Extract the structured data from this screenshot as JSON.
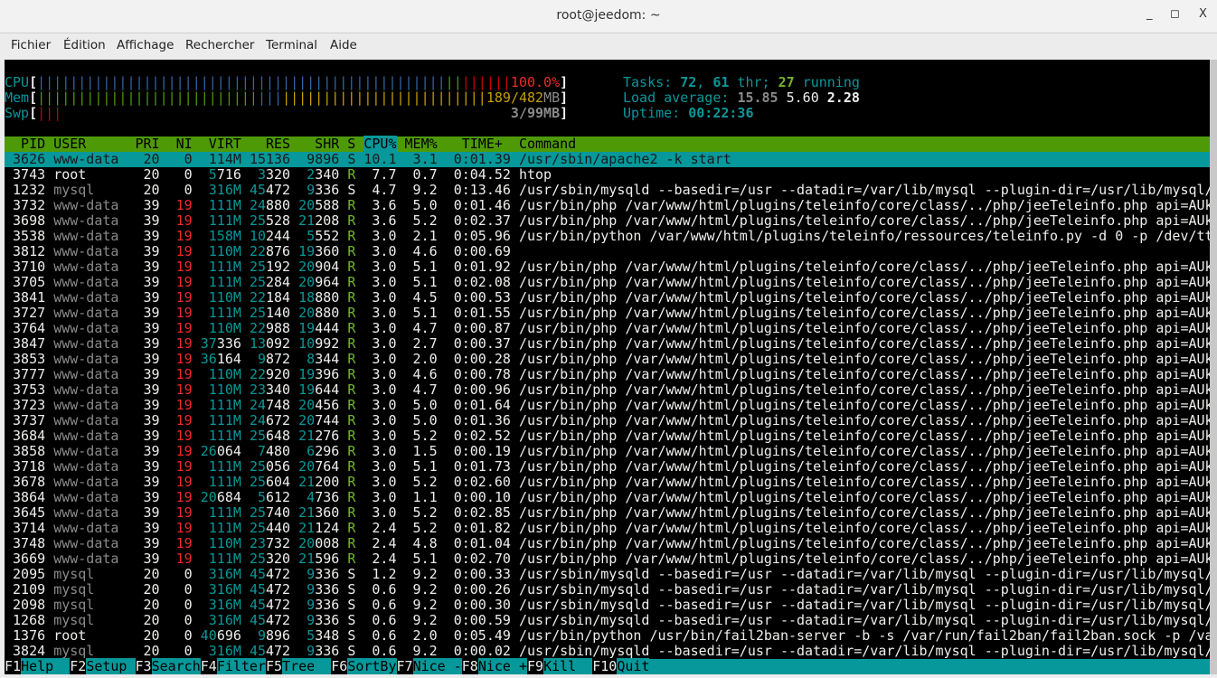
{
  "window": {
    "title": "root@jeedom: ~",
    "minimize": "_",
    "maximize": "◻",
    "close": "X"
  },
  "menu": [
    "Fichier",
    "Édition",
    "Affichage",
    "Rechercher",
    "Terminal",
    "Aide"
  ],
  "meters": {
    "cpu": {
      "label": "CPU",
      "text": "100.0%",
      "segments": [
        {
          "color": "#3465a4",
          "count": 50
        },
        {
          "color": "#4e9a06",
          "count": 2
        },
        {
          "color": "#cc0000",
          "count": 6
        }
      ]
    },
    "mem": {
      "label": "Mem",
      "used": "189",
      "total": "482",
      "unit": "MB",
      "segments": [
        {
          "color": "#4e9a06",
          "count": 27
        },
        {
          "color": "#3465a4",
          "count": 3
        },
        {
          "color": "#c4a000",
          "count": 25
        }
      ]
    },
    "swp": {
      "label": "Swp",
      "text": "3/99MB",
      "segments": [
        {
          "color": "#cc0000",
          "count": 3
        }
      ]
    }
  },
  "stats": {
    "tasks_label": "Tasks: ",
    "tasks": "72",
    "thr": "61",
    "thr_label": " thr; ",
    "running": "27",
    "running_label": " running",
    "load_label": "Load average: ",
    "load1": "15.85",
    "load5": "5.60",
    "load15": "2.28",
    "uptime_label": "Uptime: ",
    "uptime": "00:22:36"
  },
  "columns": [
    "PID",
    "USER",
    "PRI",
    "NI",
    "VIRT",
    "RES",
    "SHR",
    "S",
    "CPU%",
    "MEM%",
    "TIME+",
    "Command"
  ],
  "sort_column": "CPU%",
  "commands": {
    "mysqld": "/usr/sbin/mysqld --basedir=/usr --datadir=/var/lib/mysql --plugin-dir=/usr/lib/mysql/",
    "php": "/usr/bin/php /var/www/html/plugins/teleinfo/core/class/../php/jeeTeleinfo.php api=AUk",
    "python": "/usr/bin/python /var/www/html/plugins/teleinfo/ressources/teleinfo.py -d 0 -p /dev/tt",
    "fail2ban": "/usr/bin/python /usr/bin/fail2ban-server -b -s /var/run/fail2ban/fail2ban.sock -p /va",
    "apache": "/usr/sbin/apache2 -k start",
    "htop": "htop",
    "none": ""
  },
  "processes": [
    [
      "3626",
      "www-data",
      "20",
      "0",
      "114M",
      "15136",
      "9896",
      "S",
      "10.1",
      "3.1",
      "0:01.39",
      "apache",
      true
    ],
    [
      "3743",
      "root",
      "20",
      "0",
      "5716",
      "3320",
      "2340",
      "R",
      "7.7",
      "0.7",
      "0:04.52",
      "htop"
    ],
    [
      "1232",
      "mysql",
      "20",
      "0",
      "316M",
      "45472",
      "9336",
      "S",
      "4.7",
      "9.2",
      "0:13.46",
      "mysqld"
    ],
    [
      "3732",
      "www-data",
      "39",
      "19",
      "111M",
      "24880",
      "20588",
      "R",
      "3.6",
      "5.0",
      "0:01.46",
      "php"
    ],
    [
      "3698",
      "www-data",
      "39",
      "19",
      "111M",
      "25528",
      "21208",
      "R",
      "3.6",
      "5.2",
      "0:02.37",
      "php"
    ],
    [
      "3538",
      "www-data",
      "39",
      "19",
      "158M",
      "10244",
      "5552",
      "R",
      "3.0",
      "2.1",
      "0:05.96",
      "python"
    ],
    [
      "3812",
      "www-data",
      "39",
      "19",
      "110M",
      "22876",
      "19360",
      "R",
      "3.0",
      "4.6",
      "0:00.69",
      "none"
    ],
    [
      "3710",
      "www-data",
      "39",
      "19",
      "111M",
      "25192",
      "20904",
      "R",
      "3.0",
      "5.1",
      "0:01.92",
      "php"
    ],
    [
      "3705",
      "www-data",
      "39",
      "19",
      "111M",
      "25284",
      "20964",
      "R",
      "3.0",
      "5.1",
      "0:02.08",
      "php"
    ],
    [
      "3841",
      "www-data",
      "39",
      "19",
      "110M",
      "22184",
      "18880",
      "R",
      "3.0",
      "4.5",
      "0:00.53",
      "php"
    ],
    [
      "3727",
      "www-data",
      "39",
      "19",
      "111M",
      "25140",
      "20880",
      "R",
      "3.0",
      "5.1",
      "0:01.55",
      "php"
    ],
    [
      "3764",
      "www-data",
      "39",
      "19",
      "110M",
      "22988",
      "19444",
      "R",
      "3.0",
      "4.7",
      "0:00.87",
      "php"
    ],
    [
      "3847",
      "www-data",
      "39",
      "19",
      "37336",
      "13092",
      "10992",
      "R",
      "3.0",
      "2.7",
      "0:00.37",
      "php"
    ],
    [
      "3853",
      "www-data",
      "39",
      "19",
      "36164",
      "9872",
      "8344",
      "R",
      "3.0",
      "2.0",
      "0:00.28",
      "php"
    ],
    [
      "3777",
      "www-data",
      "39",
      "19",
      "110M",
      "22920",
      "19396",
      "R",
      "3.0",
      "4.6",
      "0:00.78",
      "php"
    ],
    [
      "3753",
      "www-data",
      "39",
      "19",
      "110M",
      "23340",
      "19644",
      "R",
      "3.0",
      "4.7",
      "0:00.96",
      "php"
    ],
    [
      "3723",
      "www-data",
      "39",
      "19",
      "111M",
      "24748",
      "20456",
      "R",
      "3.0",
      "5.0",
      "0:01.64",
      "php"
    ],
    [
      "3737",
      "www-data",
      "39",
      "19",
      "111M",
      "24672",
      "20744",
      "R",
      "3.0",
      "5.0",
      "0:01.36",
      "php"
    ],
    [
      "3684",
      "www-data",
      "39",
      "19",
      "111M",
      "25648",
      "21276",
      "R",
      "3.0",
      "5.2",
      "0:02.52",
      "php"
    ],
    [
      "3858",
      "www-data",
      "39",
      "19",
      "26064",
      "7480",
      "6296",
      "R",
      "3.0",
      "1.5",
      "0:00.19",
      "php"
    ],
    [
      "3718",
      "www-data",
      "39",
      "19",
      "111M",
      "25056",
      "20764",
      "R",
      "3.0",
      "5.1",
      "0:01.73",
      "php"
    ],
    [
      "3678",
      "www-data",
      "39",
      "19",
      "111M",
      "25604",
      "21200",
      "R",
      "3.0",
      "5.2",
      "0:02.60",
      "php"
    ],
    [
      "3864",
      "www-data",
      "39",
      "19",
      "20684",
      "5612",
      "4736",
      "R",
      "3.0",
      "1.1",
      "0:00.10",
      "php"
    ],
    [
      "3645",
      "www-data",
      "39",
      "19",
      "111M",
      "25740",
      "21360",
      "R",
      "3.0",
      "5.2",
      "0:02.85",
      "php"
    ],
    [
      "3714",
      "www-data",
      "39",
      "19",
      "111M",
      "25440",
      "21124",
      "R",
      "2.4",
      "5.2",
      "0:01.82",
      "php"
    ],
    [
      "3748",
      "www-data",
      "39",
      "19",
      "110M",
      "23732",
      "20008",
      "R",
      "2.4",
      "4.8",
      "0:01.04",
      "php"
    ],
    [
      "3669",
      "www-data",
      "39",
      "19",
      "111M",
      "25320",
      "21596",
      "R",
      "2.4",
      "5.1",
      "0:02.70",
      "php"
    ],
    [
      "2095",
      "mysql",
      "20",
      "0",
      "316M",
      "45472",
      "9336",
      "S",
      "1.2",
      "9.2",
      "0:00.33",
      "mysqld"
    ],
    [
      "2109",
      "mysql",
      "20",
      "0",
      "316M",
      "45472",
      "9336",
      "S",
      "0.6",
      "9.2",
      "0:00.26",
      "mysqld"
    ],
    [
      "2098",
      "mysql",
      "20",
      "0",
      "316M",
      "45472",
      "9336",
      "S",
      "0.6",
      "9.2",
      "0:00.30",
      "mysqld"
    ],
    [
      "1268",
      "mysql",
      "20",
      "0",
      "316M",
      "45472",
      "9336",
      "S",
      "0.6",
      "9.2",
      "0:00.59",
      "mysqld"
    ],
    [
      "1376",
      "root",
      "20",
      "0",
      "40696",
      "9896",
      "5348",
      "S",
      "0.6",
      "2.0",
      "0:05.49",
      "fail2ban"
    ],
    [
      "3824",
      "mysql",
      "20",
      "0",
      "316M",
      "45472",
      "9336",
      "S",
      "0.6",
      "9.2",
      "0:00.02",
      "mysqld"
    ]
  ],
  "function_keys": [
    {
      "key": "F1",
      "label": "Help  "
    },
    {
      "key": "F2",
      "label": "Setup "
    },
    {
      "key": "F3",
      "label": "Search"
    },
    {
      "key": "F4",
      "label": "Filter"
    },
    {
      "key": "F5",
      "label": "Tree  "
    },
    {
      "key": "F6",
      "label": "SortBy"
    },
    {
      "key": "F7",
      "label": "Nice -"
    },
    {
      "key": "F8",
      "label": "Nice +"
    },
    {
      "key": "F9",
      "label": "Kill  "
    },
    {
      "key": "F10",
      "label": "Quit"
    }
  ]
}
